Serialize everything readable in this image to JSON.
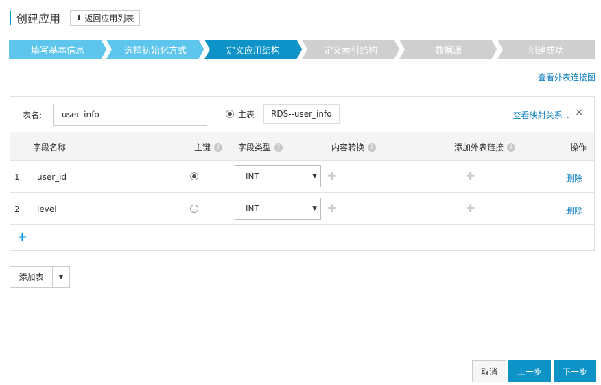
{
  "header": {
    "title": "创建应用",
    "back_label": "返回应用列表"
  },
  "steps": [
    {
      "label": "填写基本信息",
      "state": "done"
    },
    {
      "label": "选择初始化方式",
      "state": "done"
    },
    {
      "label": "定义应用结构",
      "state": "active"
    },
    {
      "label": "定义索引结构",
      "state": "pending"
    },
    {
      "label": "数据源",
      "state": "pending"
    },
    {
      "label": "创建成功",
      "state": "pending"
    }
  ],
  "colors": {
    "done": "#5ec5ec",
    "active": "#0e93c9",
    "pending": "#cfcfcf"
  },
  "links": {
    "external_table": "查看外表连接图"
  },
  "table": {
    "name_label": "表名:",
    "name_value": "user_info",
    "main_label": "主表",
    "datasource": "RDS--user_info",
    "mapping_label": "查看映射关系",
    "close": "×",
    "columns": {
      "field_name": "字段名称",
      "primary_key": "主键",
      "field_type": "字段类型",
      "content_transform": "内容转换",
      "add_ext_link": "添加外表链接",
      "action": "操作"
    },
    "rows": [
      {
        "idx": "1",
        "name": "user_id",
        "pk": true,
        "type": "INT",
        "delete": "删除"
      },
      {
        "idx": "2",
        "name": "level",
        "pk": false,
        "type": "INT",
        "delete": "删除"
      }
    ]
  },
  "buttons": {
    "add_table": "添加表",
    "cancel": "取消",
    "prev": "上一步",
    "next": "下一步"
  }
}
